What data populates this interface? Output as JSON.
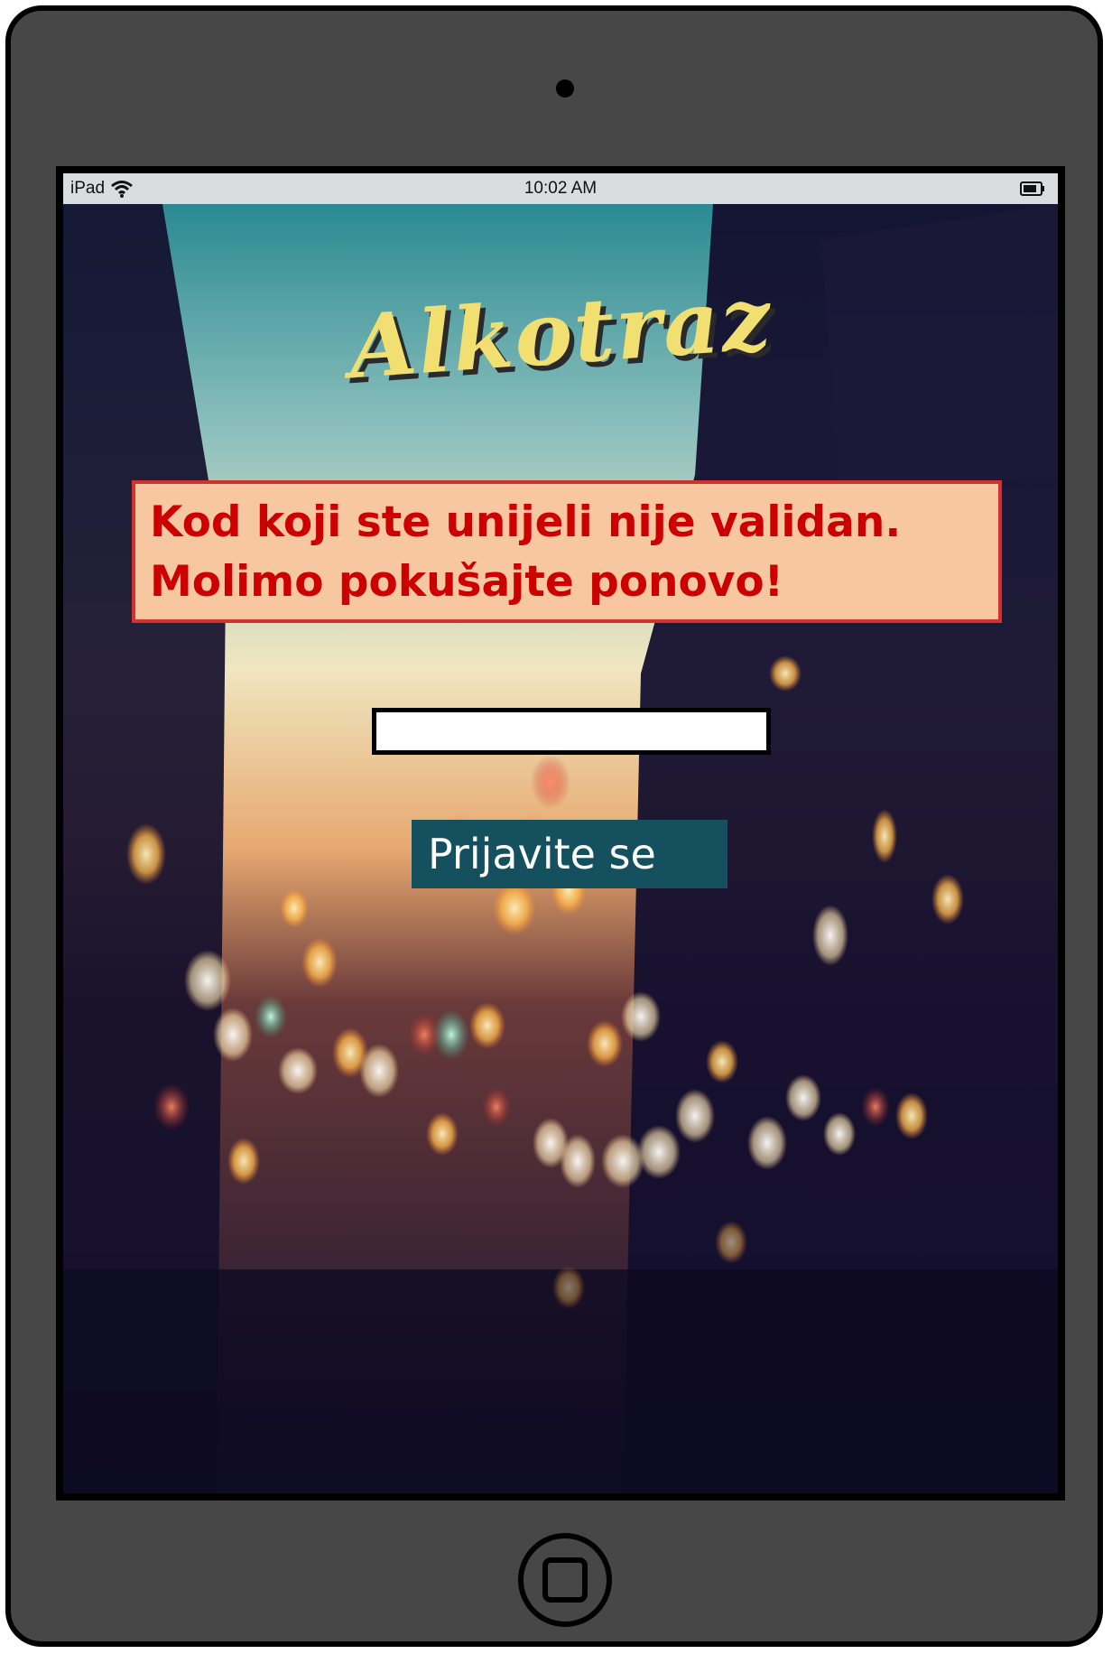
{
  "status_bar": {
    "device": "iPad",
    "time": "10:02 AM",
    "wifi_icon": "wifi-icon",
    "battery_icon": "battery-icon"
  },
  "app": {
    "title": "Alkotraz"
  },
  "error": {
    "line1": "Kod koji ste unijeli nije validan.",
    "line2": "Molimo pokušajte ponovo!"
  },
  "code_input": {
    "value": "",
    "placeholder": ""
  },
  "login_button": {
    "label": "Prijavite se"
  },
  "colors": {
    "device_body": "#474747",
    "status_bar": "#d9dde0",
    "title": "#f1df72",
    "error_bg": "#f7c7a1",
    "error_border": "#d2312f",
    "error_text": "#cc0000",
    "button_bg": "#14505d",
    "button_text": "#ffffff"
  }
}
